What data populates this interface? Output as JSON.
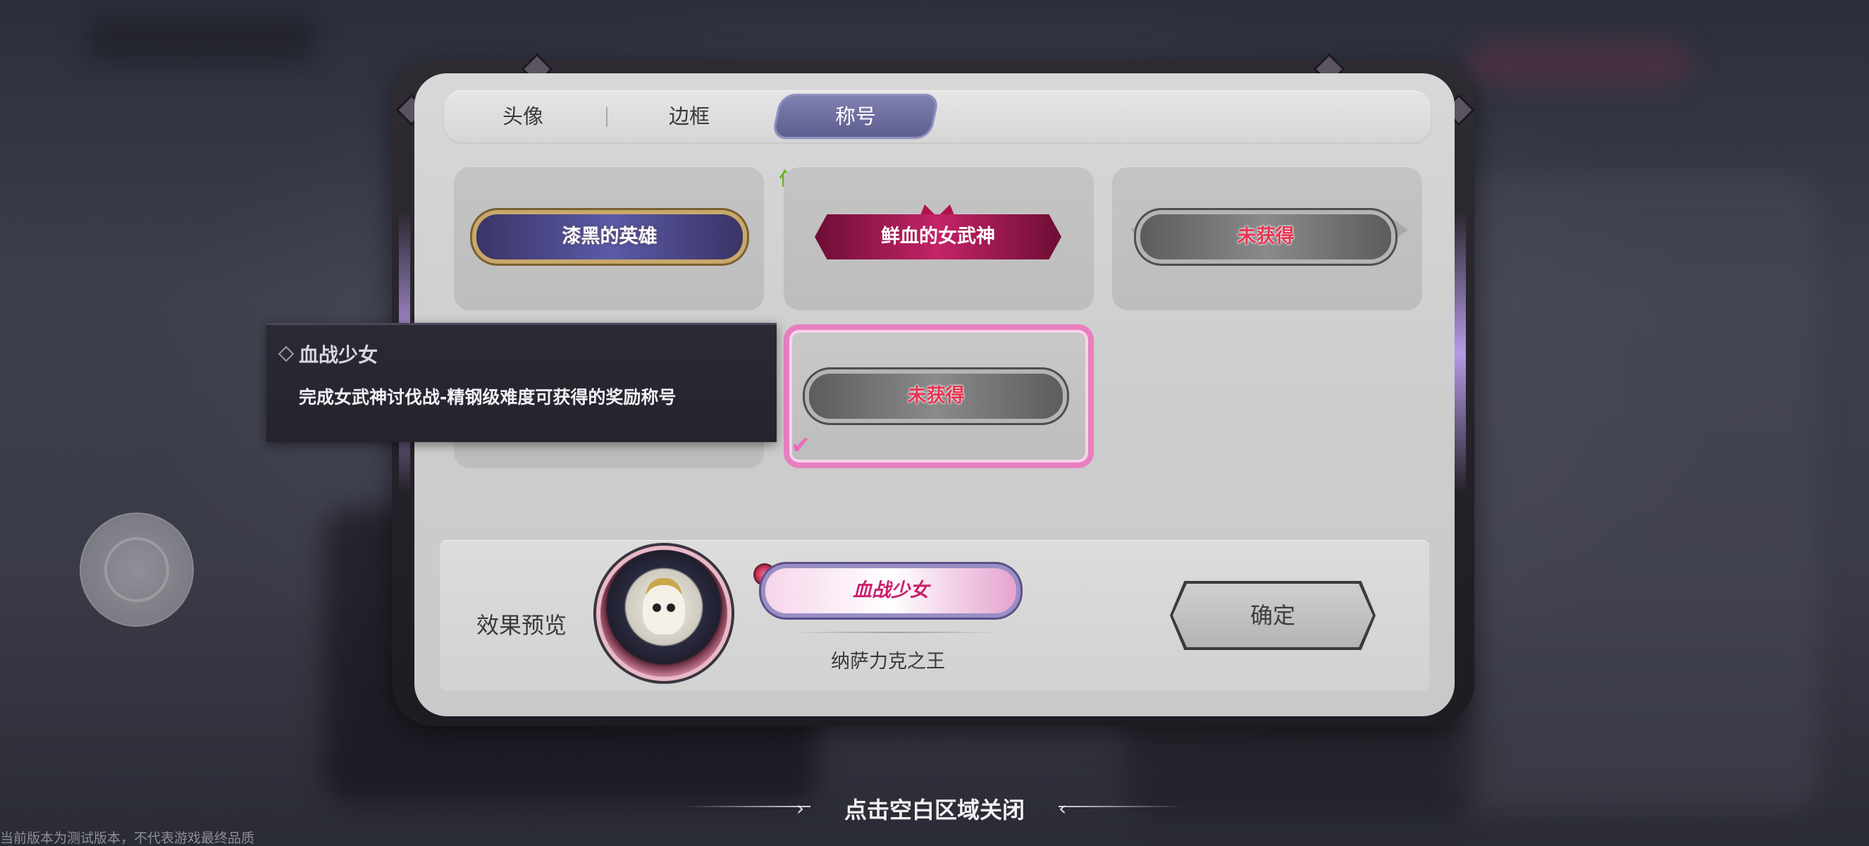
{
  "tabs": {
    "avatar": "头像",
    "border": "边框",
    "title": "称号",
    "active": "title"
  },
  "titles": {
    "in_use_label": "使用中",
    "items": [
      {
        "name": "漆黑的英雄",
        "state": "owned"
      },
      {
        "name": "鲜血的女武神",
        "state": "in-use"
      },
      {
        "name": "未获得",
        "state": "locked"
      },
      {
        "name": "",
        "state": "locked-hidden"
      },
      {
        "name": "未获得",
        "state": "locked-selected"
      }
    ]
  },
  "tooltip": {
    "title": "血战少女",
    "description": "完成女武神讨伐战-精钢级难度可获得的奖励称号"
  },
  "preview": {
    "label": "效果预览",
    "badge": "血战少女",
    "player_name": "纳萨力克之王",
    "confirm": "确定"
  },
  "footer": {
    "close_hint": "点击空白区域关闭",
    "version_note": "当前版本为测试版本，不代表游戏最终品质"
  },
  "colors": {
    "active_tab": "#6e6ea0",
    "selected_border": "#e87fc0",
    "in_use_text": "#6db02a",
    "locked_text": "#e83552"
  }
}
